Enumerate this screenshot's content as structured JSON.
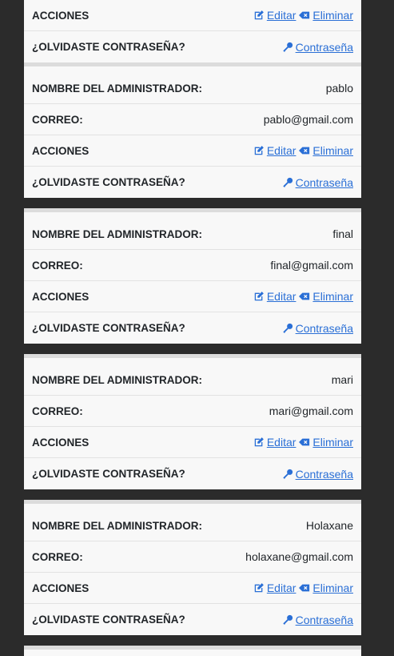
{
  "labels": {
    "name": "NOMBRE DEL ADMINISTRADOR:",
    "email": "CORREO:",
    "actions": "ACCIONES",
    "forgot": "¿OLVIDASTE CONTRASEÑA?"
  },
  "links": {
    "edit": "Editar",
    "delete": "Eliminar",
    "password": "Contraseña"
  },
  "admins": [
    {
      "name": "pablo",
      "email": "pablo@gmail.com"
    },
    {
      "name": "final",
      "email": "final@gmail.com"
    },
    {
      "name": "mari",
      "email": "mari@gmail.com"
    },
    {
      "name": "Holaxane",
      "email": "holaxane@gmail.com"
    }
  ],
  "colors": {
    "link": "#2a6fd6",
    "background": "#2b2b2b",
    "card": "#f8f8f8"
  },
  "icons": {
    "edit": "pencil-square-icon",
    "delete": "backspace-x-icon",
    "password": "key-icon"
  }
}
